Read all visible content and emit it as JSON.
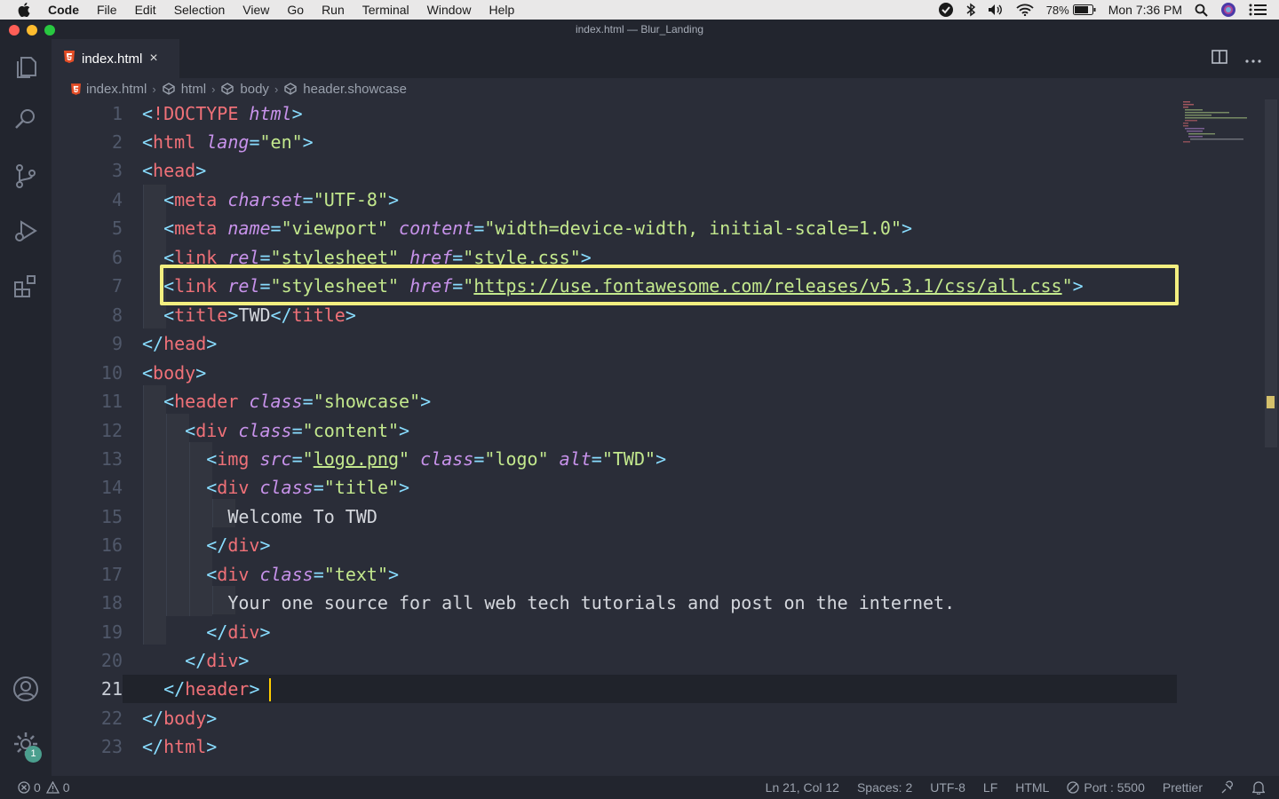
{
  "menubar": {
    "items": [
      "Code",
      "File",
      "Edit",
      "Selection",
      "View",
      "Go",
      "Run",
      "Terminal",
      "Window",
      "Help"
    ],
    "battery": "78%",
    "clock": "Mon 7:36 PM"
  },
  "window": {
    "title": "index.html — Blur_Landing"
  },
  "tab": {
    "label": "index.html",
    "close": "×"
  },
  "breadcrumb": [
    "index.html",
    "html",
    "body",
    "header.showcase"
  ],
  "editor": {
    "line_numbers": [
      "1",
      "2",
      "3",
      "4",
      "5",
      "6",
      "7",
      "8",
      "9",
      "10",
      "11",
      "12",
      "13",
      "14",
      "15",
      "16",
      "17",
      "18",
      "19",
      "20",
      "21",
      "22",
      "23"
    ],
    "lines": [
      "<!DOCTYPE html>",
      "<html lang=\"en\">",
      "<head>",
      "  <meta charset=\"UTF-8\">",
      "  <meta name=\"viewport\" content=\"width=device-width, initial-scale=1.0\">",
      "  <link rel=\"stylesheet\" href=\"style.css\">",
      "  <link rel=\"stylesheet\" href=\"https://use.fontawesome.com/releases/v5.3.1/css/all.css\">",
      "  <title>TWD</title>",
      "</head>",
      "<body>",
      "  <header class=\"showcase\">",
      "    <div class=\"content\">",
      "      <img src=\"logo.png\" class=\"logo\" alt=\"TWD\">",
      "      <div class=\"title\">",
      "        Welcome To TWD",
      "      </div>",
      "      <div class=\"text\">",
      "        Your one source for all web tech tutorials and post on the internet.",
      "      </div>",
      "    </div>",
      "  </header>",
      "</body>",
      "</html>"
    ],
    "tokens": {
      "doctype": "!DOCTYPE",
      "html_kw": "html",
      "html": "html",
      "lang": "lang",
      "en": "\"en\"",
      "head": "head",
      "meta": "meta",
      "charset": "charset",
      "utf8": "\"UTF-8\"",
      "name": "name",
      "viewport": "\"viewport\"",
      "content": "content",
      "viewport_val": "\"width=device-width, initial-scale=1.0\"",
      "link": "link",
      "rel": "rel",
      "stylesheet": "\"stylesheet\"",
      "href": "href",
      "style_css": "style.css",
      "fa_url": "https://use.fontawesome.com/releases/v5.3.1/css/all.css",
      "title": "title",
      "twd": "TWD",
      "body": "body",
      "header": "header",
      "class": "class",
      "showcase": "\"showcase\"",
      "div": "div",
      "content_cls": "\"content\"",
      "img": "img",
      "src": "src",
      "logo_png": "logo.png",
      "logo_cls": "\"logo\"",
      "alt": "alt",
      "twd_q": "\"TWD\"",
      "title_cls": "\"title\"",
      "welcome": "Welcome To TWD",
      "text_cls": "\"text\"",
      "tagline": "Your one source for all web tech tutorials and post on the internet."
    }
  },
  "statusbar": {
    "errors": "0",
    "warnings": "0",
    "position": "Ln 21, Col 12",
    "spaces": "Spaces: 2",
    "encoding": "UTF-8",
    "eol": "LF",
    "language": "HTML",
    "port": "Port : 5500",
    "formatter": "Prettier"
  },
  "activity": {
    "settings_badge": "1"
  },
  "colors": {
    "accent_highlight": "#f3ef80",
    "cursor": "#ffcc00",
    "tag": "#f07178",
    "attribute": "#c792ea",
    "string": "#c3e88d",
    "punctuation": "#89ddff"
  }
}
